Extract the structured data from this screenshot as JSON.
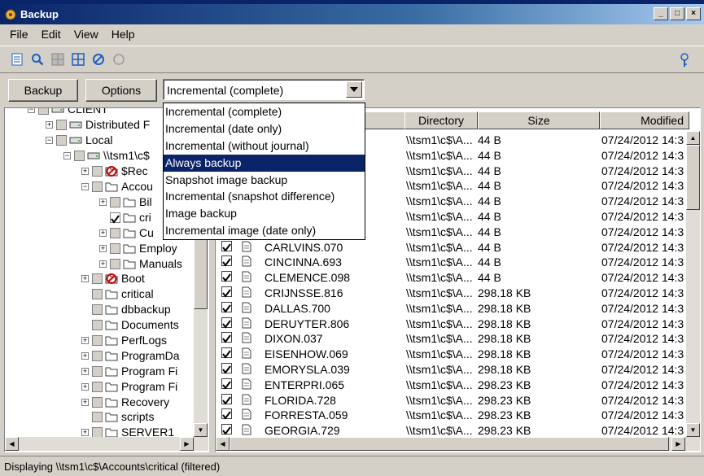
{
  "window": {
    "title": "Backup",
    "controls": [
      "_",
      "□",
      "×"
    ]
  },
  "menu": [
    "File",
    "Edit",
    "View",
    "Help"
  ],
  "actions": {
    "backup_label": "Backup",
    "options_label": "Options"
  },
  "combo": {
    "selected": "Incremental (complete)",
    "options": [
      "Incremental (complete)",
      "Incremental (date only)",
      "Incremental (without journal)",
      "Always backup",
      "Snapshot image backup",
      "Incremental (snapshot difference)",
      "Image backup",
      "Incremental image (date only)"
    ],
    "highlighted": "Always backup"
  },
  "tree": [
    {
      "label": "CLIENT",
      "indent": 0,
      "exp": "-"
    },
    {
      "label": "Distributed F",
      "indent": 1,
      "exp": "+"
    },
    {
      "label": "Local",
      "indent": 1,
      "exp": "-"
    },
    {
      "label": "\\\\tsm1\\c$",
      "indent": 2,
      "exp": "-"
    },
    {
      "label": "$Rec",
      "indent": 3,
      "exp": "+"
    },
    {
      "label": "Accou",
      "indent": 3,
      "exp": "-"
    },
    {
      "label": "Bil",
      "indent": 4,
      "exp": "+"
    },
    {
      "label": "cri",
      "indent": 4,
      "exp": ""
    },
    {
      "label": "Cu",
      "indent": 4,
      "exp": "+"
    },
    {
      "label": "Employ",
      "indent": 4,
      "exp": "+"
    },
    {
      "label": "Manuals",
      "indent": 4,
      "exp": "+"
    },
    {
      "label": "Boot",
      "indent": 3,
      "exp": "+"
    },
    {
      "label": "critical",
      "indent": 3,
      "exp": ""
    },
    {
      "label": "dbbackup",
      "indent": 3,
      "exp": ""
    },
    {
      "label": "Documents",
      "indent": 3,
      "exp": ""
    },
    {
      "label": "PerfLogs",
      "indent": 3,
      "exp": "+"
    },
    {
      "label": "ProgramDa",
      "indent": 3,
      "exp": "+"
    },
    {
      "label": "Program Fi",
      "indent": 3,
      "exp": "+"
    },
    {
      "label": "Program Fi",
      "indent": 3,
      "exp": "+"
    },
    {
      "label": "Recovery",
      "indent": 3,
      "exp": "+"
    },
    {
      "label": "scripts",
      "indent": 3,
      "exp": ""
    },
    {
      "label": "SERVER1",
      "indent": 3,
      "exp": "+"
    }
  ],
  "columns": {
    "directory": "Directory",
    "size": "Size",
    "modified": "Modified"
  },
  "files": [
    {
      "name": "",
      "dir": "\\\\tsm1\\c$\\A...",
      "size": "44 B",
      "mod": "07/24/2012 14:3"
    },
    {
      "name": "",
      "dir": "\\\\tsm1\\c$\\A...",
      "size": "44 B",
      "mod": "07/24/2012 14:3"
    },
    {
      "name": "",
      "dir": "\\\\tsm1\\c$\\A...",
      "size": "44 B",
      "mod": "07/24/2012 14:3"
    },
    {
      "name": "",
      "dir": "\\\\tsm1\\c$\\A...",
      "size": "44 B",
      "mod": "07/24/2012 14:3"
    },
    {
      "name": "",
      "dir": "\\\\tsm1\\c$\\A...",
      "size": "44 B",
      "mod": "07/24/2012 14:3"
    },
    {
      "name": "",
      "dir": "\\\\tsm1\\c$\\A...",
      "size": "44 B",
      "mod": "07/24/2012 14:3"
    },
    {
      "name": "",
      "dir": "\\\\tsm1\\c$\\A...",
      "size": "44 B",
      "mod": "07/24/2012 14:3"
    },
    {
      "name": "CARLVINS.070",
      "dir": "\\\\tsm1\\c$\\A...",
      "size": "44 B",
      "mod": "07/24/2012 14:3"
    },
    {
      "name": "CINCINNA.693",
      "dir": "\\\\tsm1\\c$\\A...",
      "size": "44 B",
      "mod": "07/24/2012 14:3"
    },
    {
      "name": "CLEMENCE.098",
      "dir": "\\\\tsm1\\c$\\A...",
      "size": "44 B",
      "mod": "07/24/2012 14:3"
    },
    {
      "name": "CRIJNSSE.816",
      "dir": "\\\\tsm1\\c$\\A...",
      "size": "298.18 KB",
      "mod": "07/24/2012 14:3"
    },
    {
      "name": "DALLAS.700",
      "dir": "\\\\tsm1\\c$\\A...",
      "size": "298.18 KB",
      "mod": "07/24/2012 14:3"
    },
    {
      "name": "DERUYTER.806",
      "dir": "\\\\tsm1\\c$\\A...",
      "size": "298.18 KB",
      "mod": "07/24/2012 14:3"
    },
    {
      "name": "DIXON.037",
      "dir": "\\\\tsm1\\c$\\A...",
      "size": "298.18 KB",
      "mod": "07/24/2012 14:3"
    },
    {
      "name": "EISENHOW.069",
      "dir": "\\\\tsm1\\c$\\A...",
      "size": "298.18 KB",
      "mod": "07/24/2012 14:3"
    },
    {
      "name": "EMORYSLA.039",
      "dir": "\\\\tsm1\\c$\\A...",
      "size": "298.18 KB",
      "mod": "07/24/2012 14:3"
    },
    {
      "name": "ENTERPRI.065",
      "dir": "\\\\tsm1\\c$\\A...",
      "size": "298.23 KB",
      "mod": "07/24/2012 14:3"
    },
    {
      "name": "FLORIDA.728",
      "dir": "\\\\tsm1\\c$\\A...",
      "size": "298.23 KB",
      "mod": "07/24/2012 14:3"
    },
    {
      "name": "FORRESTA.059",
      "dir": "\\\\tsm1\\c$\\A...",
      "size": "298.23 KB",
      "mod": "07/24/2012 14:3"
    },
    {
      "name": "GEORGIA.729",
      "dir": "\\\\tsm1\\c$\\A...",
      "size": "298.23 KB",
      "mod": "07/24/2012 14:3"
    }
  ],
  "status": "Displaying \\\\tsm1\\c$\\Accounts\\critical (filtered)",
  "colors": {
    "title_bar": "#0a246a",
    "selection": "#0a246a",
    "tool_icon": "#1f5fbf"
  }
}
